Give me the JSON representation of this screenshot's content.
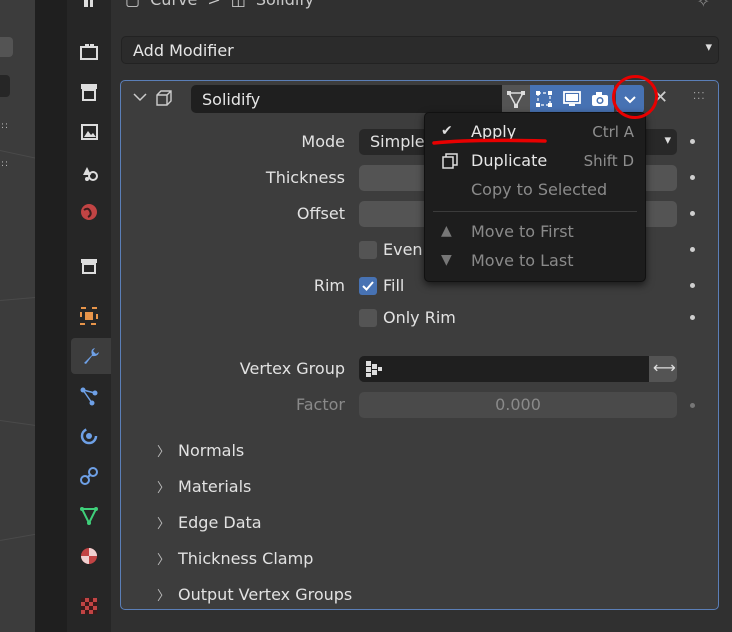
{
  "breadcrumb": {
    "object": "Curve",
    "sep": ">",
    "modifier": "Solidify"
  },
  "add_modifier": {
    "label": "Add Modifier"
  },
  "modifier": {
    "name": "Solidify",
    "fields": {
      "mode_label": "Mode",
      "mode_value": "Simple",
      "thickness_label": "Thickness",
      "offset_label": "Offset",
      "even_label": "Even",
      "rim_label": "Rim",
      "fill_label": "Fill",
      "only_rim_label": "Only Rim",
      "vertex_group_label": "Vertex Group",
      "factor_label": "Factor",
      "factor_value": "0.000"
    },
    "checkboxes": {
      "even": false,
      "fill": true,
      "only_rim": false
    },
    "subpanels": [
      "Normals",
      "Materials",
      "Edge Data",
      "Thickness Clamp",
      "Output Vertex Groups"
    ]
  },
  "menu": {
    "items": [
      {
        "label": "Apply",
        "shortcut": "Ctrl A",
        "icon": "checkmark-icon",
        "enabled": true
      },
      {
        "label": "Duplicate",
        "shortcut": "Shift D",
        "icon": "duplicate-icon",
        "enabled": true
      },
      {
        "label": "Copy to Selected",
        "shortcut": "",
        "icon": "",
        "enabled": false
      },
      {
        "label": "Move to First",
        "shortcut": "",
        "icon": "triangle-up-icon",
        "enabled": false
      },
      {
        "label": "Move to Last",
        "shortcut": "",
        "icon": "triangle-down-icon",
        "enabled": false
      }
    ]
  },
  "colors": {
    "accent": "#4772b3",
    "panel_border": "#5b7fb8",
    "annotation": "#e80000"
  }
}
